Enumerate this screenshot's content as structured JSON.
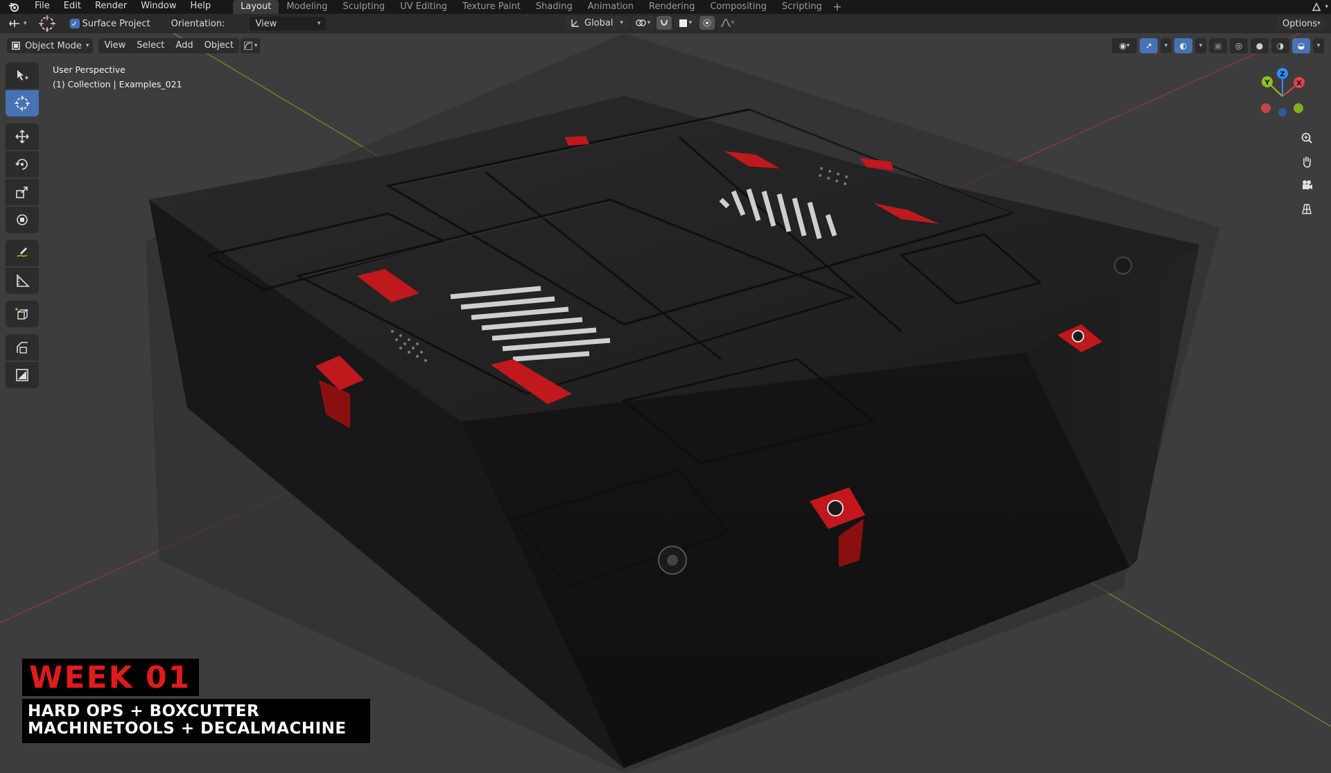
{
  "menu": {
    "items": [
      "File",
      "Edit",
      "Render",
      "Window",
      "Help"
    ]
  },
  "workspaces": {
    "tabs": [
      "Layout",
      "Modeling",
      "Sculpting",
      "UV Editing",
      "Texture Paint",
      "Shading",
      "Animation",
      "Rendering",
      "Compositing",
      "Scripting"
    ],
    "active": "Layout"
  },
  "tool_header": {
    "surface_project_label": "Surface Project",
    "surface_project_checked": true,
    "orientation_label": "Orientation:",
    "orientation_value": "View",
    "transform_orientation": "Global",
    "options_label": "Options"
  },
  "view_header": {
    "mode": "Object Mode",
    "menus": [
      "View",
      "Select",
      "Add",
      "Object"
    ]
  },
  "viewport": {
    "perspective_label": "User Perspective",
    "collection_label": "(1) Collection | Examples_021"
  },
  "gizmo": {
    "axes": [
      "X",
      "Y",
      "Z"
    ],
    "colors": {
      "x": "#e0434b",
      "y": "#8fc11f",
      "z": "#2c8fff"
    }
  },
  "badge": {
    "week": "WEEK 01",
    "line1": "HARD OPS + BOXCUTTER",
    "line2": "MACHINETOOLS + DECALMACHINE"
  },
  "icons": {
    "toolbar": [
      "select-box-icon",
      "cursor-icon",
      "move-icon",
      "rotate-icon",
      "scale-icon",
      "transform-icon",
      "annotate-icon",
      "measure-icon",
      "add-cube-icon",
      "bevel-icon",
      "scale-cage-icon"
    ],
    "nav": [
      "zoom-icon",
      "hand-icon",
      "camera-icon",
      "grid-icon"
    ]
  },
  "colors": {
    "accent": "#4772b3",
    "viewport_bg": "#3d3d3d",
    "badge_red": "#e01b1b"
  }
}
